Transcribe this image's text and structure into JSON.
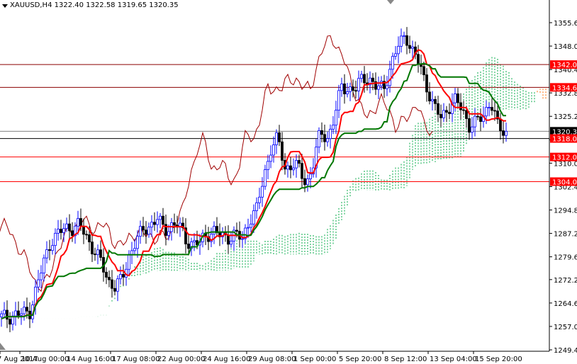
{
  "header": {
    "symbol_timeframe": "XAUUSD,H4",
    "open": "1322.40",
    "high": "1322.58",
    "low": "1319.65",
    "close": "1320.35"
  },
  "chart_data": {
    "type": "candlestick",
    "title": "XAUUSD,H4",
    "indicator": {
      "name": "Ichimoku",
      "tenkan": 9,
      "kijun": 26,
      "senkou": 52
    },
    "ylim": [
      1249.4,
      1355.6
    ],
    "y_ticks": [
      "1355.60",
      "1348.00",
      "1340.40",
      "1332.80",
      "1325.20",
      "1317.60",
      "1310.00",
      "1302.40",
      "1294.80",
      "1287.20",
      "1279.60",
      "1272.20",
      "1264.60",
      "1257.00",
      "1249.40"
    ],
    "x_labels": [
      "7 Aug 2017",
      "10 Aug 00:00",
      "14 Aug 16:00",
      "17 Aug 08:00",
      "22 Aug 00:00",
      "24 Aug 16:00",
      "29 Aug 08:00",
      "1 Sep 00:00",
      "5 Sep 20:00",
      "8 Sep 12:00",
      "13 Sep 04:00",
      "15 Sep 20:00"
    ],
    "x_label_bar_index": [
      0,
      16,
      32,
      48,
      64,
      80,
      96,
      112,
      128,
      144,
      160,
      176
    ],
    "sample_every_bars": 2.5,
    "closes": [
      1260,
      1260,
      1261,
      1261,
      1262,
      1270,
      1278,
      1285,
      1287,
      1289,
      1289,
      1290,
      1286,
      1282,
      1278,
      1272,
      1270,
      1272,
      1280,
      1285,
      1288,
      1290,
      1292,
      1288,
      1290,
      1290,
      1285,
      1284,
      1284,
      1287,
      1288,
      1286,
      1286,
      1287,
      1285,
      1292,
      1295,
      1305,
      1315,
      1318,
      1308,
      1310,
      1308,
      1303,
      1310,
      1320,
      1318,
      1325,
      1335,
      1334,
      1334,
      1338,
      1337,
      1334,
      1335,
      1342,
      1348,
      1352,
      1346,
      1342,
      1335,
      1328,
      1325,
      1328,
      1330,
      1328,
      1322,
      1323,
      1326,
      1330,
      1322,
      1320.35
    ],
    "levels": [
      {
        "price": 1342.0,
        "label": "1342.00",
        "color": "#8b0000"
      },
      {
        "price": 1334.6,
        "label": "1334.60",
        "color": "#8b0000"
      },
      {
        "price": 1320.35,
        "label": "1320.35",
        "color": "#808080"
      },
      {
        "price": 1318.0,
        "label": "1318.00",
        "color": "#000000"
      },
      {
        "price": 1312.0,
        "label": "1312.00",
        "color": "#ff0000"
      },
      {
        "price": 1304.0,
        "label": "1304.00",
        "color": "#ff0000"
      }
    ],
    "colors": {
      "bull": "#0000ff",
      "bear": "#000000",
      "tenkan": "#ff0000",
      "kijun": "#007700",
      "chikou": "#a00000",
      "cloud_up": "#00aa44",
      "cloud_down": "#ff6a00",
      "level_label": "#ff0000",
      "current_label": "#000000"
    }
  }
}
